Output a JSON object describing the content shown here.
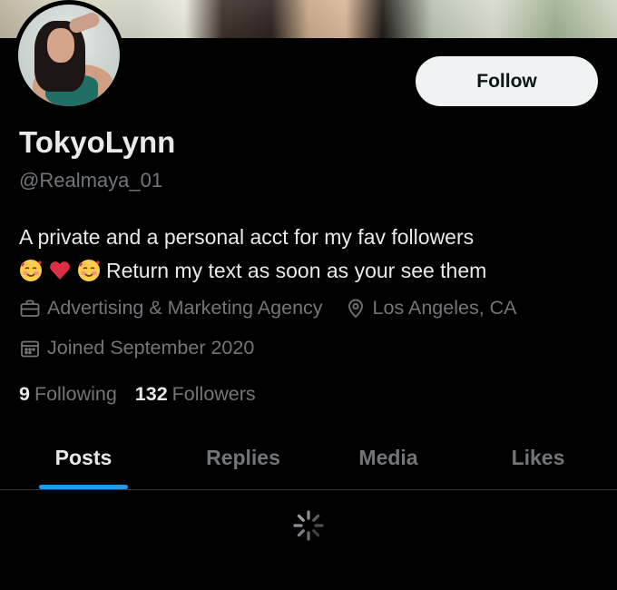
{
  "profile": {
    "display_name": "TokyoLynn",
    "handle": "@Realmaya_01",
    "bio_line1": "A private and a personal acct for my fav followers",
    "bio_line2": "Return my text as soon as your see them",
    "bio_emojis": [
      "smiling-face-with-hearts",
      "red-heart",
      "smiling-face-with-hearts"
    ],
    "category": "Advertising & Marketing Agency",
    "location": "Los Angeles, CA",
    "joined": "Joined September 2020",
    "following_count": "9",
    "following_label": "Following",
    "followers_count": "132",
    "followers_label": "Followers"
  },
  "actions": {
    "follow_label": "Follow"
  },
  "tabs": [
    {
      "label": "Posts",
      "active": true
    },
    {
      "label": "Replies",
      "active": false
    },
    {
      "label": "Media",
      "active": false
    },
    {
      "label": "Likes",
      "active": false
    }
  ],
  "icons": {
    "category": "briefcase-icon",
    "location": "location-pin-icon",
    "joined": "calendar-icon",
    "loading": "loading-spinner-icon"
  },
  "colors": {
    "background": "#000000",
    "text_primary": "#e7e9ea",
    "text_secondary": "#71767b",
    "accent": "#1d9bf0",
    "follow_button_bg": "#eff3f4"
  }
}
